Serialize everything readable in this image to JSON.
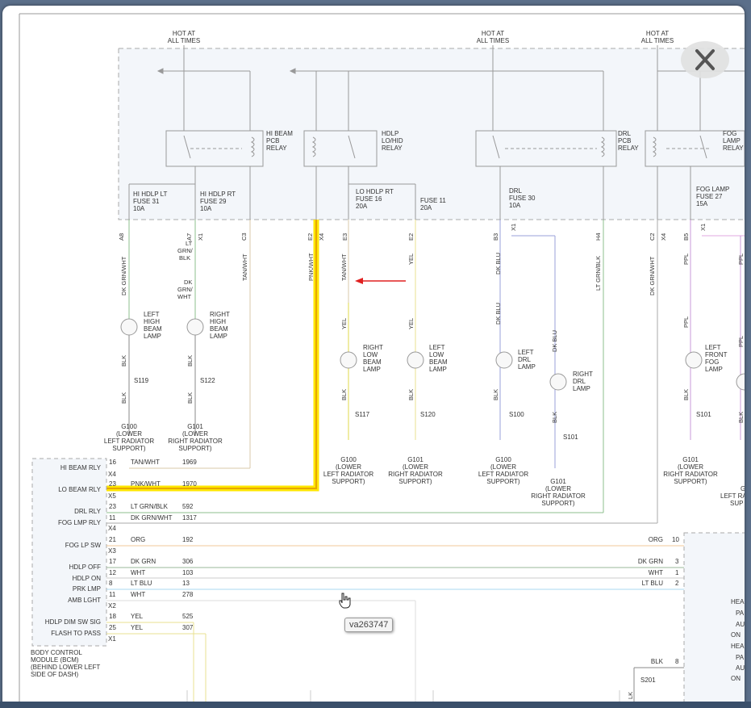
{
  "tooltip": "va263747",
  "hot_labels": [
    "HOT AT",
    "ALL TIMES"
  ],
  "relays": {
    "hi_beam": [
      "HI BEAM",
      "PCB",
      "RELAY"
    ],
    "hdlp": [
      "HDLP",
      "LO/HID",
      "RELAY"
    ],
    "drl": [
      "DRL",
      "PCB",
      "RELAY"
    ],
    "fog": [
      "FOG",
      "LAMP",
      "RELAY"
    ]
  },
  "fuses": {
    "hi_lt": [
      "HI HDLP LT",
      "FUSE 31",
      "10A"
    ],
    "hi_rt": [
      "HI HDLP RT",
      "FUSE 29",
      "10A"
    ],
    "lo_rt": [
      "LO HDLP RT",
      "FUSE 16",
      "20A"
    ],
    "f11": [
      "FUSE 11",
      "20A"
    ],
    "drl": [
      "DRL",
      "FUSE 30",
      "10A"
    ],
    "fog": [
      "FOG LAMP",
      "FUSE 27",
      "15A"
    ]
  },
  "pins": {
    "a8": "A8",
    "a7": "A7",
    "x1": "X1",
    "c3": "C3",
    "e2": "E2",
    "x4": "X4",
    "e3": "E3",
    "e2b": "E2",
    "b3": "B3",
    "x1b": "X1",
    "h4": "H4",
    "c2": "C2",
    "x4b": "X4",
    "b5": "B5",
    "x1c": "X1"
  },
  "wire_colors": {
    "dk_grn_wht": "DK GRN/WHT",
    "lt_grn_blk": [
      "LT",
      "GRN/",
      "BLK"
    ],
    "dk_grn_wht2": [
      "DK",
      "GRN/",
      "WHT"
    ],
    "tan_wht": "TAN/WHT",
    "pnk_wht": "PNK/WHT",
    "tan_wht2": "TAN/WHT",
    "yel": "YEL",
    "dk_blu": "DK BLU",
    "lt_grn_blk2": "LT GRN/BLK",
    "dk_grn_wht3": "DK GRN/WHT",
    "ppl": "PPL",
    "blk": "BLK"
  },
  "lamps": {
    "left_high": [
      "LEFT",
      "HIGH",
      "BEAM",
      "LAMP"
    ],
    "right_high": [
      "RIGHT",
      "HIGH",
      "BEAM",
      "LAMP"
    ],
    "right_low": [
      "RIGHT",
      "LOW",
      "BEAM",
      "LAMP"
    ],
    "left_low": [
      "LEFT",
      "LOW",
      "BEAM",
      "LAMP"
    ],
    "left_drl": [
      "LEFT",
      "DRL",
      "LAMP"
    ],
    "right_drl": [
      "RIGHT",
      "DRL",
      "LAMP"
    ],
    "left_fog": [
      "LEFT",
      "FRONT",
      "FOG",
      "LAMP"
    ]
  },
  "splices": {
    "s119": "S119",
    "s122": "S122",
    "s117": "S117",
    "s120": "S120",
    "s100": "S100",
    "s101a": "S101",
    "s101b": "S101",
    "s201": "S201"
  },
  "grounds": {
    "g100a": [
      "G100",
      "(LOWER",
      "LEFT RADIATOR",
      "SUPPORT)"
    ],
    "g101a": [
      "G101",
      "(LOWER",
      "RIGHT RADIATOR",
      "SUPPORT)"
    ],
    "g100b": [
      "G100",
      "(LOWER",
      "LEFT RADIATOR",
      "SUPPORT)"
    ],
    "g101b": [
      "G101",
      "(LOWER",
      "RIGHT RADIATOR",
      "SUPPORT)"
    ],
    "g100c": [
      "G100",
      "(LOWER",
      "LEFT RADIATOR",
      "SUPPORT)"
    ],
    "g101c": [
      "G101",
      "(LOWER",
      "RIGHT RADIATOR",
      "SUPPORT)"
    ],
    "g101d": [
      "G101",
      "(LOWER",
      "RIGHT RADIATOR",
      "SUPPORT)"
    ],
    "g_partial": [
      "G",
      "LEFT RA",
      "SUP"
    ]
  },
  "bcm": {
    "labels": [
      "HI BEAM RLY",
      "LO BEAM RLY",
      "DRL RLY",
      "FOG LMP RLY",
      "FOG LP SW",
      "HDLP OFF",
      "HDLP ON",
      "PRK LMP",
      "AMB LGHT",
      "HDLP DIM SW SIG",
      "FLASH TO PASS"
    ],
    "connectors": [
      "X4",
      "X5",
      "X4",
      "X3",
      "X2",
      "X1"
    ],
    "title": [
      "BODY CONTROL",
      "MODULE (BCM)",
      "(BEHIND LOWER LEFT",
      "SIDE OF DASH)"
    ]
  },
  "bcm_wires": [
    {
      "pin": "16",
      "color": "TAN/WHT",
      "circuit": "1969"
    },
    {
      "pin": "23",
      "color": "PNK/WHT",
      "circuit": "1970"
    },
    {
      "pin": "23",
      "color": "LT GRN/BLK",
      "circuit": "592"
    },
    {
      "pin": "11",
      "color": "DK GRN/WHT",
      "circuit": "1317"
    },
    {
      "pin": "21",
      "color": "ORG",
      "circuit": "192"
    },
    {
      "pin": "17",
      "color": "DK GRN",
      "circuit": "306"
    },
    {
      "pin": "12",
      "color": "WHT",
      "circuit": "103"
    },
    {
      "pin": "8",
      "color": "LT BLU",
      "circuit": "13"
    },
    {
      "pin": "11",
      "color": "WHT",
      "circuit": "278"
    },
    {
      "pin": "18",
      "color": "YEL",
      "circuit": "525"
    },
    {
      "pin": "25",
      "color": "YEL",
      "circuit": "307"
    }
  ],
  "right_wires": [
    {
      "color": "ORG",
      "pin": "10"
    },
    {
      "color": "DK GRN",
      "pin": "3"
    },
    {
      "color": "WHT",
      "pin": "1"
    },
    {
      "color": "LT BLU",
      "pin": "2"
    },
    {
      "color": "BLK",
      "pin": "8"
    }
  ],
  "right_partial": [
    "HEA",
    "PA",
    "AU",
    "ON",
    "HEA",
    "PA",
    "AU",
    "ON"
  ],
  "lk": "LK"
}
